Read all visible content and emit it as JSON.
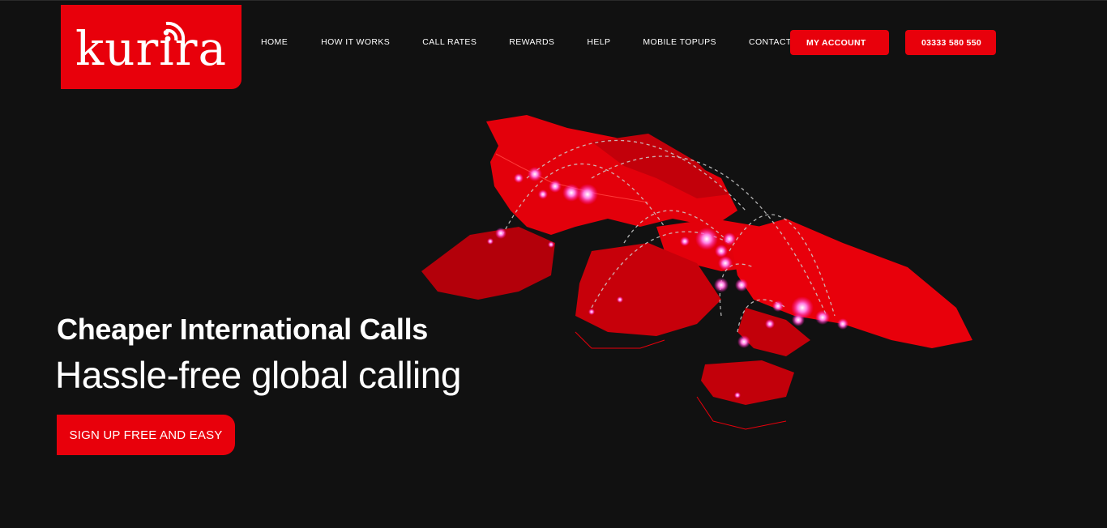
{
  "brand": {
    "name": "kurira",
    "color": "#e8000b"
  },
  "nav": {
    "items": [
      {
        "label": "HOME"
      },
      {
        "label": "HOW IT WORKS"
      },
      {
        "label": "CALL RATES"
      },
      {
        "label": "REWARDS"
      },
      {
        "label": "HELP"
      },
      {
        "label": "MOBILE TOPUPS"
      },
      {
        "label": "CONTACT"
      }
    ]
  },
  "header": {
    "account_label": "MY ACCOUNT",
    "phone_label": "03333 580 550"
  },
  "hero": {
    "title": "Cheaper International Calls",
    "subtitle": "Hassle-free global calling",
    "cta_label": "SIGN UP FREE AND EASY",
    "image_icon": "world-map-connections-icon"
  }
}
